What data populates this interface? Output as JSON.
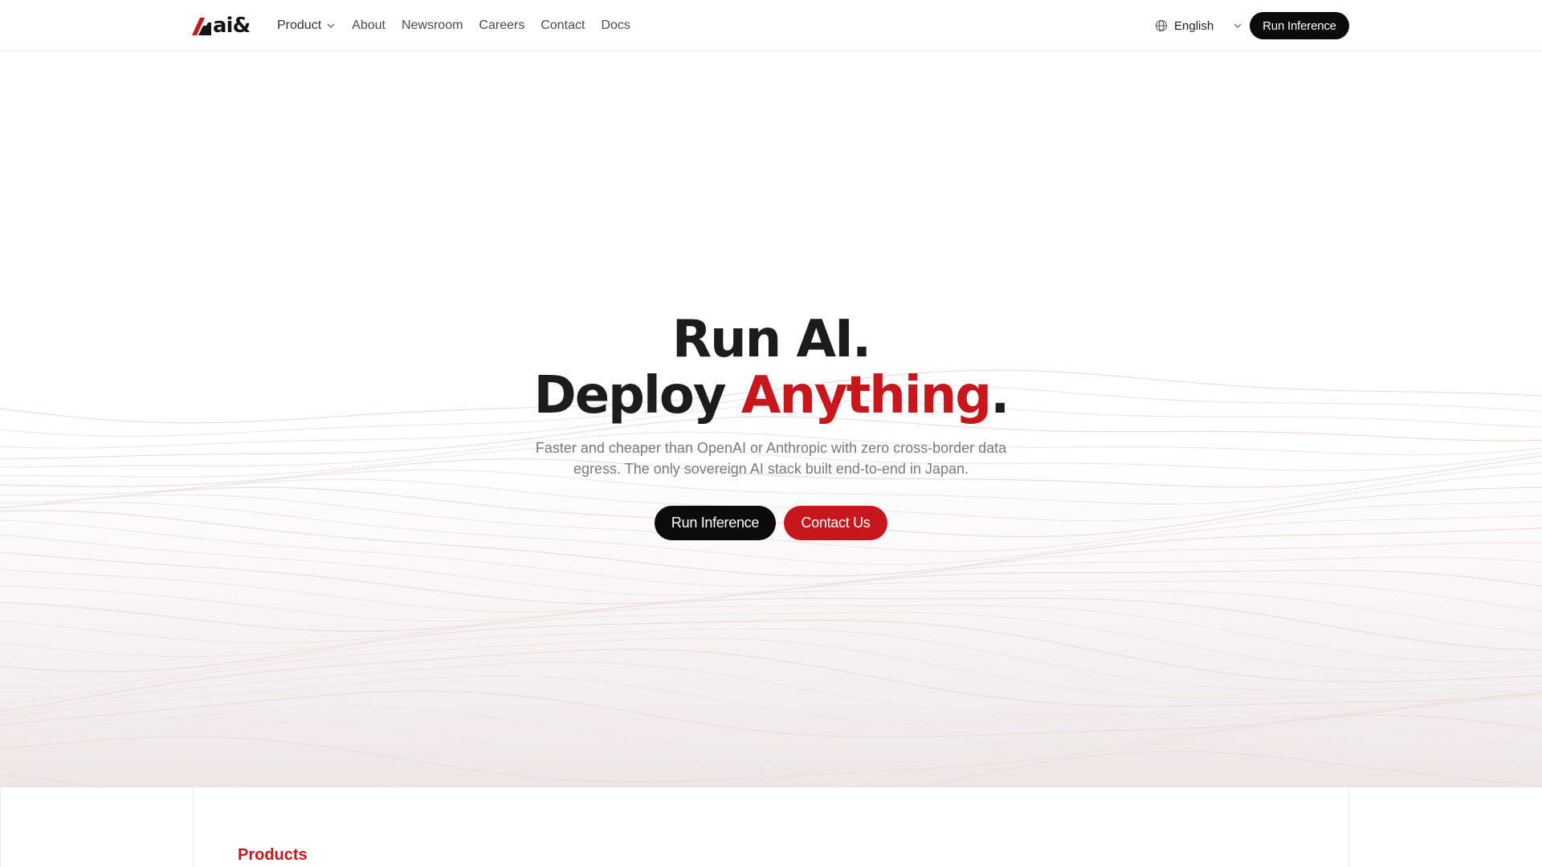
{
  "header": {
    "logo_text": "ai&",
    "nav": [
      {
        "label": "Product",
        "has_dropdown": true
      },
      {
        "label": "About"
      },
      {
        "label": "Newsroom"
      },
      {
        "label": "Careers"
      },
      {
        "label": "Contact"
      },
      {
        "label": "Docs"
      }
    ],
    "language": {
      "selected": "English",
      "icon": "globe-icon"
    },
    "cta_label": "Run Inference"
  },
  "hero": {
    "title_line1": "Run AI.",
    "title_line2_prefix": "Deploy ",
    "title_line2_accent": "Anything",
    "title_line2_suffix": ".",
    "subtitle": "Faster and cheaper than OpenAI or Anthropic with zero cross-border data egress. The only sovereign AI stack built end-to-end in Japan.",
    "primary_button": "Run Inference",
    "secondary_button": "Contact Us"
  },
  "products": {
    "section_label": "Products"
  },
  "colors": {
    "accent": "#c8161d",
    "dark": "#0b0b0b",
    "text": "#1c1c1c",
    "muted": "#7a7a7a"
  }
}
